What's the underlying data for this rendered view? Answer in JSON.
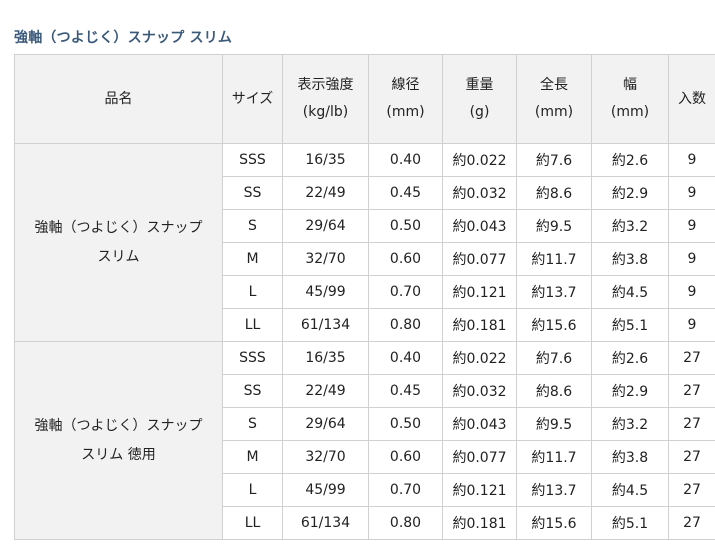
{
  "title": "強軸（つよじく）スナップ スリム",
  "headers": [
    {
      "line1": "品名",
      "line2": ""
    },
    {
      "line1": "サイズ",
      "line2": ""
    },
    {
      "line1": "表示強度",
      "line2": "(kg/lb)"
    },
    {
      "line1": "線径",
      "line2": "(mm)"
    },
    {
      "line1": "重量",
      "line2": "(g)"
    },
    {
      "line1": "全長",
      "line2": "(mm)"
    },
    {
      "line1": "幅",
      "line2": "(mm)"
    },
    {
      "line1": "入数",
      "line2": ""
    }
  ],
  "groups": [
    {
      "name_line1": "強軸（つよじく）スナップ",
      "name_line2": "スリム",
      "rows": [
        {
          "size": "SSS",
          "strength": "16/35",
          "diameter": "0.40",
          "weight": "約0.022",
          "length": "約7.6",
          "width": "約2.6",
          "qty": "9"
        },
        {
          "size": "SS",
          "strength": "22/49",
          "diameter": "0.45",
          "weight": "約0.032",
          "length": "約8.6",
          "width": "約2.9",
          "qty": "9"
        },
        {
          "size": "S",
          "strength": "29/64",
          "diameter": "0.50",
          "weight": "約0.043",
          "length": "約9.5",
          "width": "約3.2",
          "qty": "9"
        },
        {
          "size": "M",
          "strength": "32/70",
          "diameter": "0.60",
          "weight": "約0.077",
          "length": "約11.7",
          "width": "約3.8",
          "qty": "9"
        },
        {
          "size": "L",
          "strength": "45/99",
          "diameter": "0.70",
          "weight": "約0.121",
          "length": "約13.7",
          "width": "約4.5",
          "qty": "9"
        },
        {
          "size": "LL",
          "strength": "61/134",
          "diameter": "0.80",
          "weight": "約0.181",
          "length": "約15.6",
          "width": "約5.1",
          "qty": "9"
        }
      ]
    },
    {
      "name_line1": "強軸（つよじく）スナップ",
      "name_line2": "スリム 徳用",
      "rows": [
        {
          "size": "SSS",
          "strength": "16/35",
          "diameter": "0.40",
          "weight": "約0.022",
          "length": "約7.6",
          "width": "約2.6",
          "qty": "27"
        },
        {
          "size": "SS",
          "strength": "22/49",
          "diameter": "0.45",
          "weight": "約0.032",
          "length": "約8.6",
          "width": "約2.9",
          "qty": "27"
        },
        {
          "size": "S",
          "strength": "29/64",
          "diameter": "0.50",
          "weight": "約0.043",
          "length": "約9.5",
          "width": "約3.2",
          "qty": "27"
        },
        {
          "size": "M",
          "strength": "32/70",
          "diameter": "0.60",
          "weight": "約0.077",
          "length": "約11.7",
          "width": "約3.8",
          "qty": "27"
        },
        {
          "size": "L",
          "strength": "45/99",
          "diameter": "0.70",
          "weight": "約0.121",
          "length": "約13.7",
          "width": "約4.5",
          "qty": "27"
        },
        {
          "size": "LL",
          "strength": "61/134",
          "diameter": "0.80",
          "weight": "約0.181",
          "length": "約15.6",
          "width": "約5.1",
          "qty": "27"
        }
      ]
    }
  ]
}
